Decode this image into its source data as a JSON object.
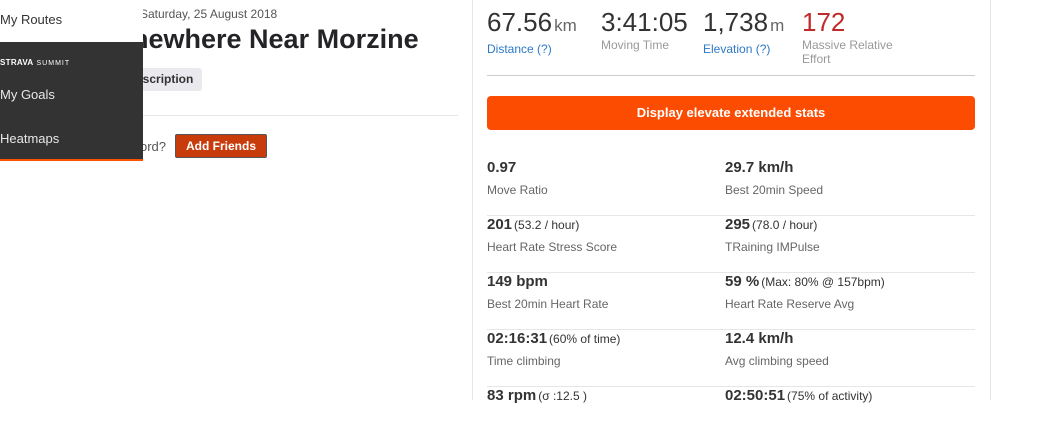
{
  "activity": {
    "date": "Saturday, 25 August 2018",
    "title": "newhere Near Morzine",
    "description_button": "escription",
    "friends_question": "ord?",
    "add_friends_label": "Add Friends"
  },
  "menu": {
    "routes": "My Routes",
    "brand": "STRAVA",
    "brand_sub": "SUMMIT",
    "goals": "My Goals",
    "heatmaps": "Heatmaps"
  },
  "stats": [
    {
      "value": "67.56",
      "unit": "km",
      "label": "Distance (?)",
      "link": true
    },
    {
      "value": "3:41:05",
      "unit": "",
      "label": "Moving Time",
      "link": false
    },
    {
      "value": "1,738",
      "unit": "m",
      "label": "Elevation (?)",
      "link": true
    },
    {
      "value": "172",
      "unit": "",
      "label": "Massive Relative Effort",
      "link": false
    }
  ],
  "elevate_button": "Display elevate extended stats",
  "extended": [
    {
      "c1": {
        "value": "0.97",
        "extra": "",
        "label": "Move Ratio"
      },
      "c2": {
        "value": "29.7 km/h",
        "extra": "",
        "label": "Best 20min Speed"
      }
    },
    {
      "c1": {
        "value": "201",
        "extra": "(53.2 / hour)",
        "label": "Heart Rate Stress Score"
      },
      "c2": {
        "value": "295",
        "extra": "(78.0 / hour)",
        "label": "TRaining IMPulse"
      }
    },
    {
      "c1": {
        "value": "149 bpm",
        "extra": "",
        "label": "Best 20min Heart Rate"
      },
      "c2": {
        "value": "59 %",
        "extra": "(Max: 80% @ 157bpm)",
        "label": "Heart Rate Reserve Avg"
      }
    },
    {
      "c1": {
        "value": "02:16:31",
        "extra": "(60% of time)",
        "label": "Time climbing"
      },
      "c2": {
        "value": "12.4 km/h",
        "extra": "",
        "label": "Avg climbing speed"
      }
    },
    {
      "c1": {
        "value": "83 rpm",
        "extra": "(σ :12.5 )",
        "label": ""
      },
      "c2": {
        "value": "02:50:51",
        "extra": "(75% of activity)",
        "label": ""
      }
    }
  ],
  "colors": {
    "accent": "#fc4c02",
    "link": "#2d79c7",
    "effort": "#c12a2a",
    "menu_dark": "#333333"
  }
}
